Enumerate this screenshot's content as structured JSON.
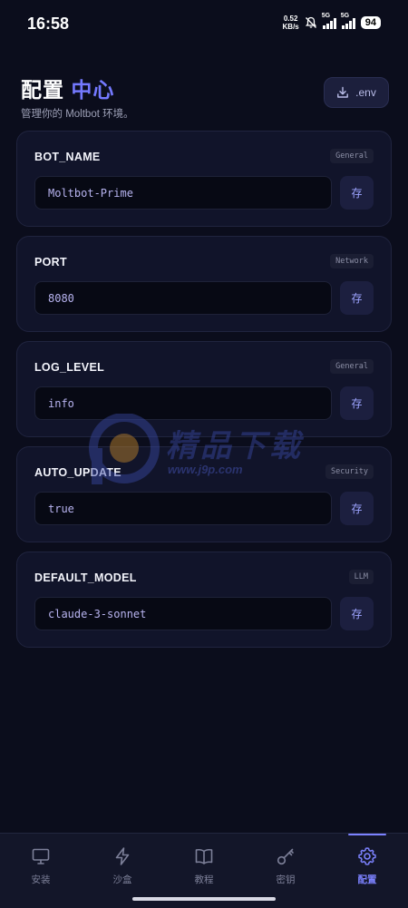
{
  "status_bar": {
    "time": "16:58",
    "net_speed_value": "0.52",
    "net_speed_unit": "KB/s",
    "sim1": "5G",
    "sim2": "5G",
    "battery": "94"
  },
  "header": {
    "title_main": "配置",
    "title_accent": "中心",
    "subtitle": "管理你的 Moltbot 环境。",
    "env_button_label": ".env"
  },
  "configs": [
    {
      "key": "BOT_NAME",
      "tag": "General",
      "value": "Moltbot-Prime",
      "save_label": "存"
    },
    {
      "key": "PORT",
      "tag": "Network",
      "value": "8080",
      "save_label": "存"
    },
    {
      "key": "LOG_LEVEL",
      "tag": "General",
      "value": "info",
      "save_label": "存"
    },
    {
      "key": "AUTO_UPDATE",
      "tag": "Security",
      "value": "true",
      "save_label": "存"
    },
    {
      "key": "DEFAULT_MODEL",
      "tag": "LLM",
      "value": "claude-3-sonnet",
      "save_label": "存"
    }
  ],
  "watermark": {
    "text": "精品下载",
    "url": "www.j9p.com"
  },
  "nav": {
    "items": [
      {
        "label": "安装",
        "icon": "monitor-icon"
      },
      {
        "label": "沙盒",
        "icon": "lightning-icon"
      },
      {
        "label": "教程",
        "icon": "book-icon"
      },
      {
        "label": "密钥",
        "icon": "key-icon"
      },
      {
        "label": "配置",
        "icon": "gear-icon"
      }
    ],
    "active": "配置"
  },
  "colors": {
    "background": "#0b0d1c",
    "accent": "#7479ff",
    "card": "#11142a"
  }
}
